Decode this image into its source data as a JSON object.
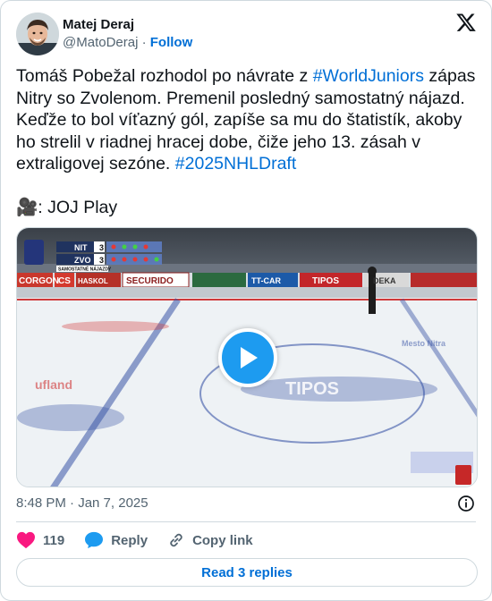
{
  "author": {
    "display_name": "Matej Deraj",
    "handle": "@MatoDeraj",
    "separator": "·",
    "follow_label": "Follow"
  },
  "tweet": {
    "text_1": "Tomáš Pobežal rozhodol po návrate z ",
    "hashtag_1": "#WorldJuniors",
    "text_2": " zápas Nitry so Zvolenom. Premenil posledný samostatný nájazd. Keďže to bol víťazný gól, zapíše sa mu do štatistík, akoby ho strelil v riadnej hracej dobe, čiže jeho 13. zásah v extraligovej sezóne. ",
    "hashtag_2": "#2025NHLDraft",
    "text_3": "\n\n🎥: JOJ Play"
  },
  "video": {
    "scorebug": {
      "team_1": "NIT",
      "score_1": "3",
      "team_2": "ZVO",
      "score_2": "3",
      "caption": "SAMOSTATNÉ NÁJAZDY"
    },
    "boards": [
      "CORGON",
      "CS",
      "HASKOL",
      "SECURIDO",
      "TT-CAR",
      "TIPOS",
      "DEKA"
    ],
    "ice_texts": [
      "TIPOS",
      "ufland",
      "Mesto Nitra"
    ]
  },
  "timestamp": "8:48 PM · Jan 7, 2025",
  "actions": {
    "likes": "119",
    "reply_label": "Reply",
    "copy_label": "Copy link"
  },
  "read_replies_label": "Read 3 replies",
  "colors": {
    "accent": "#006fd6",
    "like": "#f91880",
    "secondary_text": "#536471",
    "border": "#cfd9de"
  }
}
